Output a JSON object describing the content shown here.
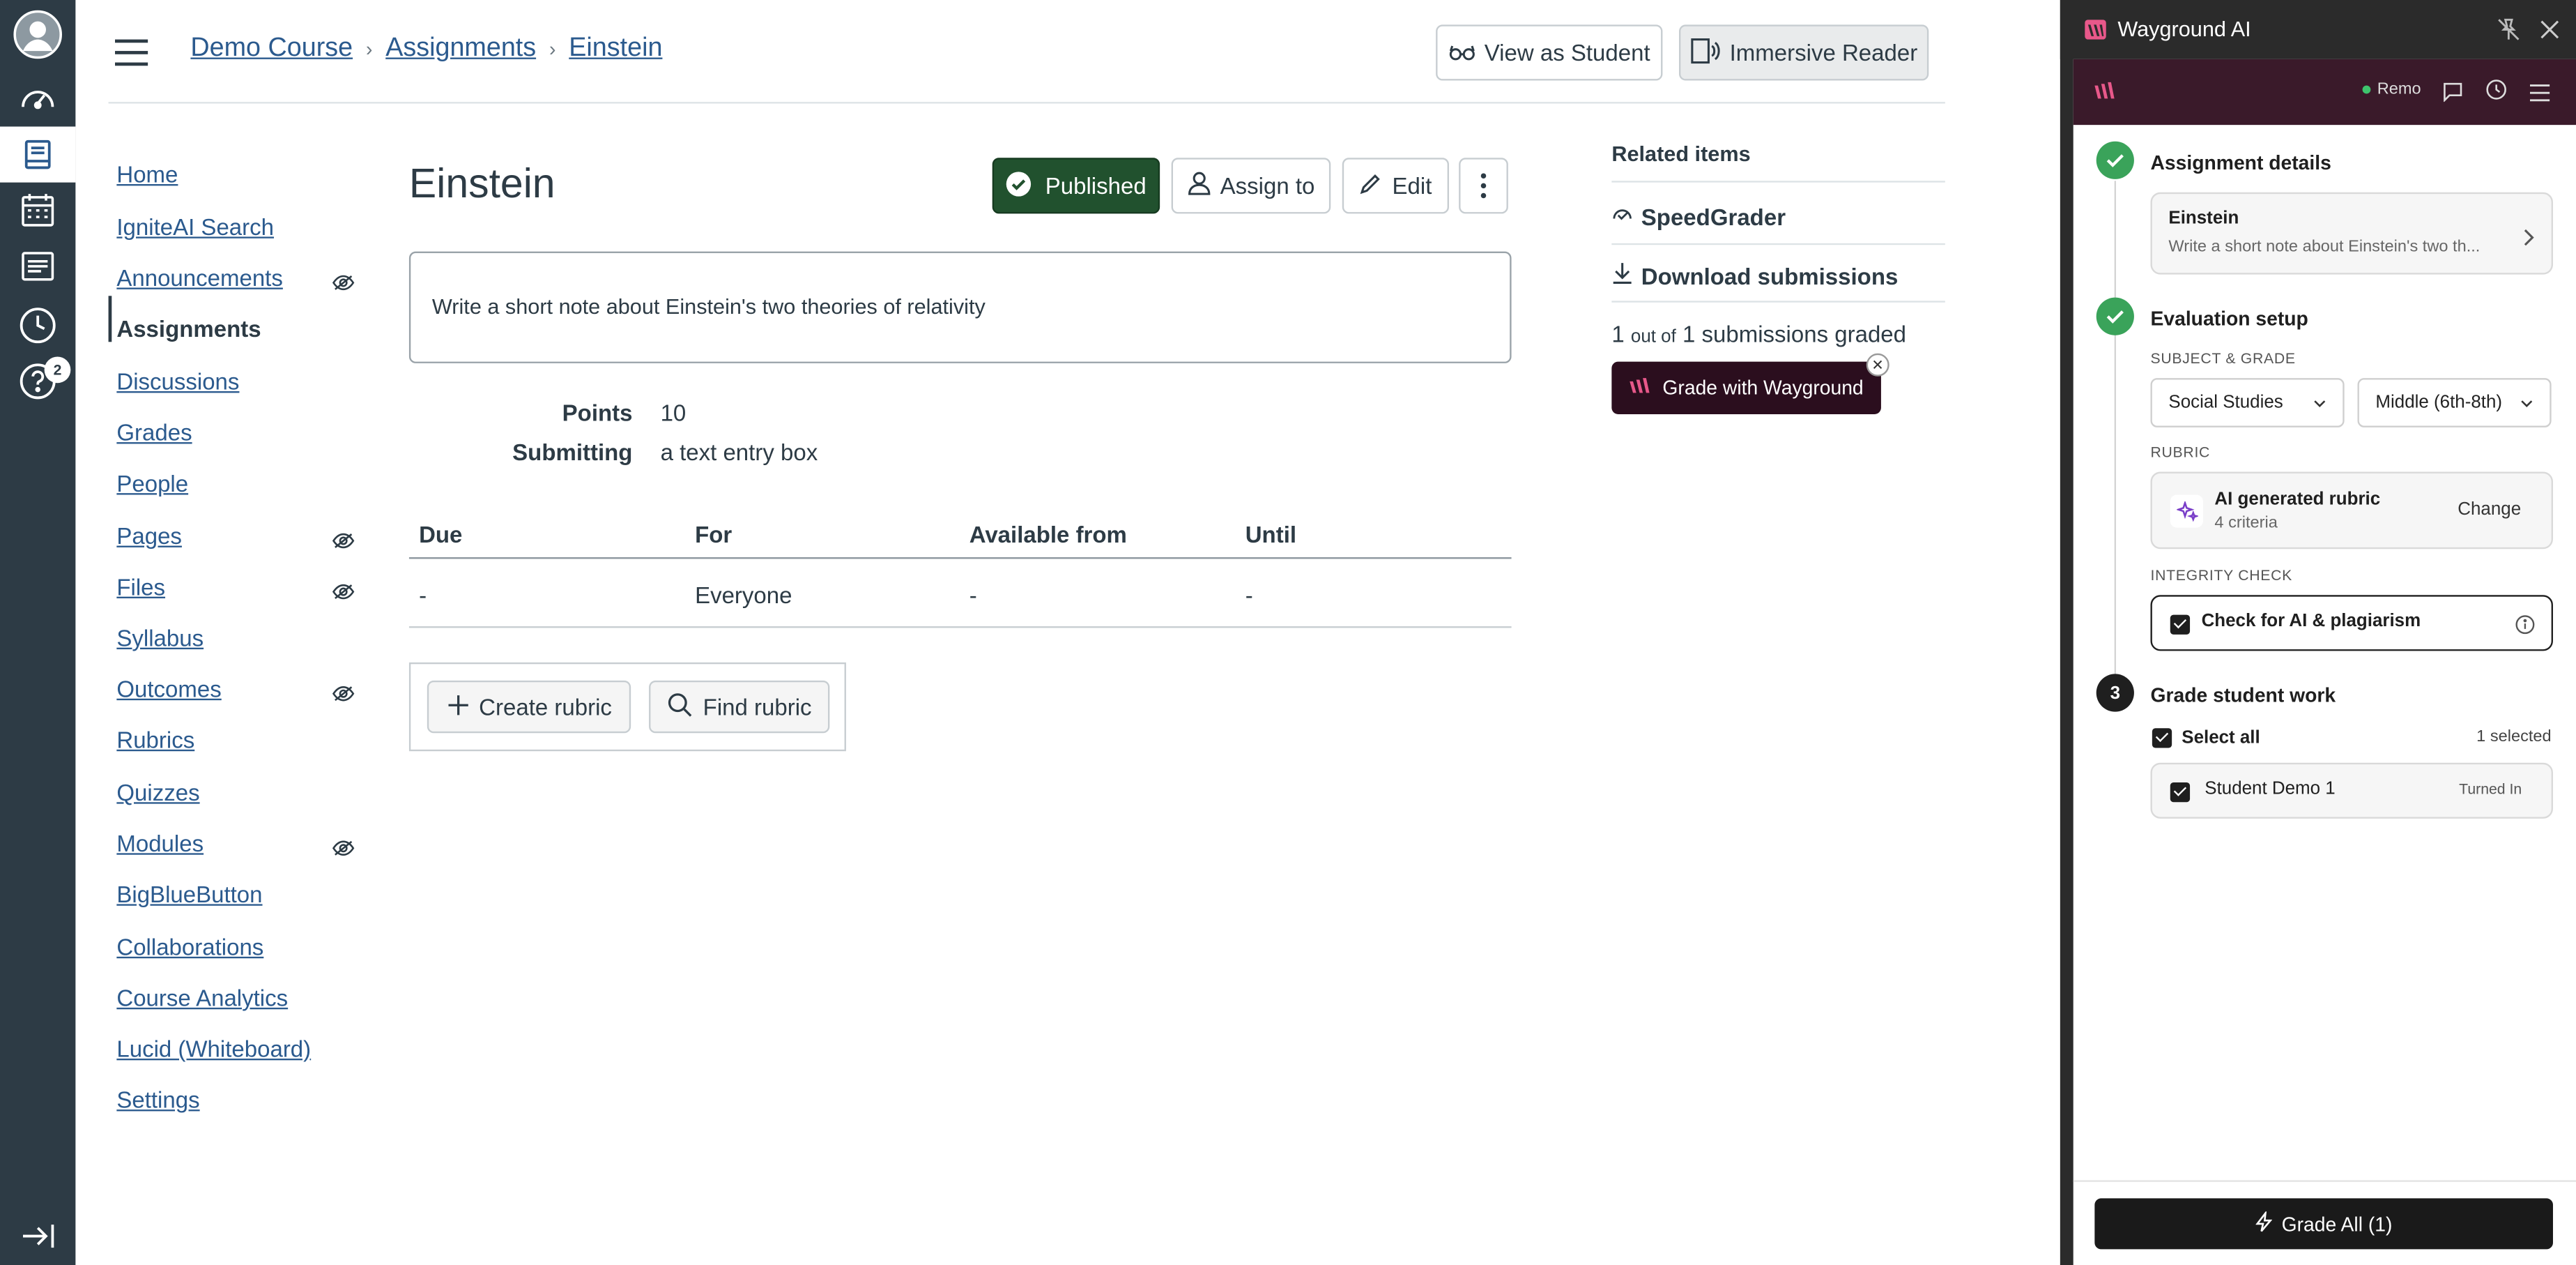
{
  "global_nav": {
    "help_badge": "2"
  },
  "breadcrumb": [
    "Demo Course",
    "Assignments",
    "Einstein"
  ],
  "header": {
    "view_as_student": "View as Student",
    "immersive_reader": "Immersive Reader"
  },
  "course_nav": [
    {
      "label": "Home",
      "hidden": false
    },
    {
      "label": "IgniteAI Search",
      "hidden": false
    },
    {
      "label": "Announcements",
      "hidden": true
    },
    {
      "label": "Assignments",
      "hidden": false,
      "current": true
    },
    {
      "label": "Discussions",
      "hidden": false
    },
    {
      "label": "Grades",
      "hidden": false
    },
    {
      "label": "People",
      "hidden": false
    },
    {
      "label": "Pages",
      "hidden": true
    },
    {
      "label": "Files",
      "hidden": true
    },
    {
      "label": "Syllabus",
      "hidden": false
    },
    {
      "label": "Outcomes",
      "hidden": true
    },
    {
      "label": "Rubrics",
      "hidden": false
    },
    {
      "label": "Quizzes",
      "hidden": false
    },
    {
      "label": "Modules",
      "hidden": true
    },
    {
      "label": "BigBlueButton",
      "hidden": false
    },
    {
      "label": "Collaborations",
      "hidden": false
    },
    {
      "label": "Course Analytics",
      "hidden": false
    },
    {
      "label": "Lucid (Whiteboard)",
      "hidden": false
    },
    {
      "label": "Settings",
      "hidden": false
    }
  ],
  "assignment": {
    "title": "Einstein",
    "published_label": "Published",
    "assign_to_label": "Assign to",
    "edit_label": "Edit",
    "description": "Write a short note about Einstein's two theories of relativity",
    "points_label": "Points",
    "points_value": "10",
    "submitting_label": "Submitting",
    "submitting_value": "a text entry box",
    "table": {
      "headers": [
        "Due",
        "For",
        "Available from",
        "Until"
      ],
      "row": [
        "-",
        "Everyone",
        "-",
        "-"
      ]
    },
    "create_rubric": "Create rubric",
    "find_rubric": "Find rubric"
  },
  "related": {
    "title": "Related items",
    "speedgrader": "SpeedGrader",
    "download": "Download submissions",
    "graded_count": "1",
    "graded_out_of": "out of",
    "graded_total": "1",
    "graded_suffix": "submissions graded",
    "grade_with_wayground": "Grade with Wayground"
  },
  "wayground": {
    "title": "Wayground AI",
    "remo_label": "Remo",
    "step1_title": "Assignment details",
    "assignment_name": "Einstein",
    "assignment_desc": "Write a short note about Einstein's two th...",
    "step2_title": "Evaluation setup",
    "subject_grade_label": "SUBJECT & GRADE",
    "subject": "Social Studies",
    "grade": "Middle (6th-8th)",
    "rubric_label": "RUBRIC",
    "rubric_name": "AI generated rubric",
    "rubric_criteria": "4 criteria",
    "rubric_change": "Change",
    "integrity_label": "INTEGRITY CHECK",
    "integrity_option": "Check for AI & plagiarism",
    "step3_number": "3",
    "step3_title": "Grade student work",
    "select_all": "Select all",
    "selected_count": "1 selected",
    "student_name": "Student Demo 1",
    "student_status": "Turned In",
    "grade_all": "Grade All (1)"
  },
  "colors": {
    "nav_bg": "#2d3b45",
    "link": "#2b5a8e",
    "published_green": "#21512e",
    "wayground_dark": "#2b0e1e",
    "step_green": "#3aa35a"
  }
}
